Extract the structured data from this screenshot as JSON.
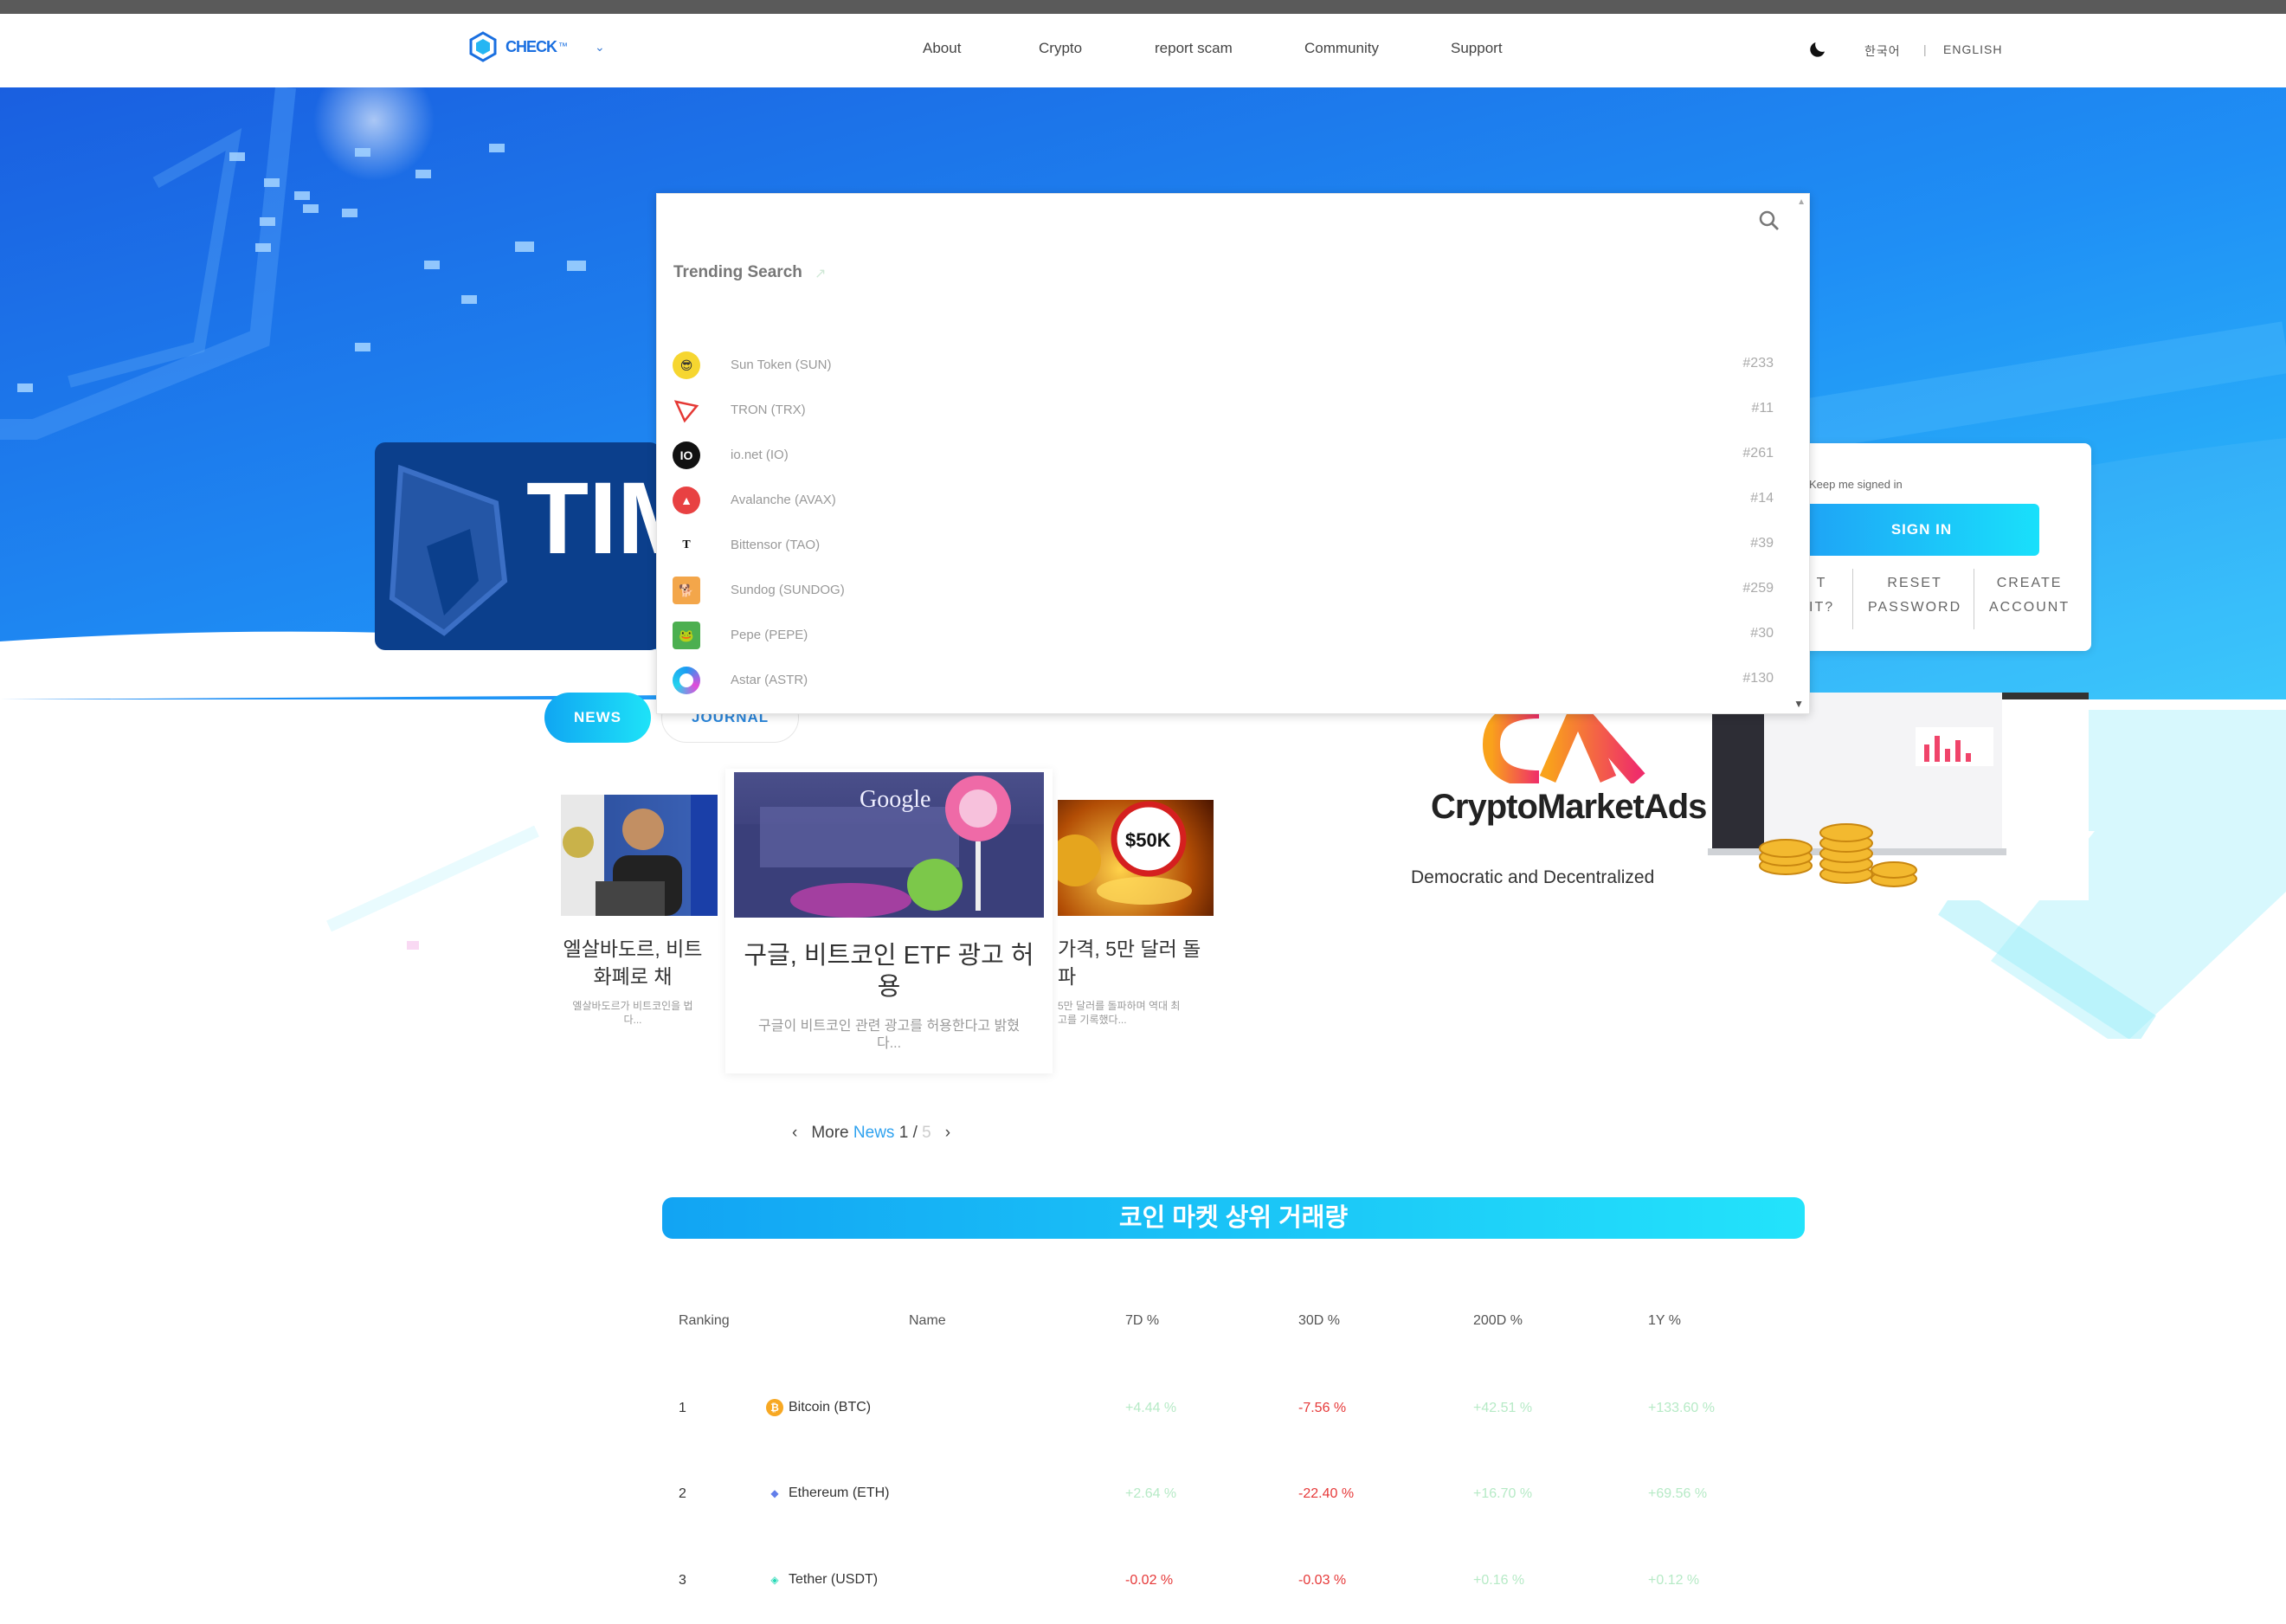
{
  "nav": {
    "logo_text": "CHECK",
    "logo_suffix": "™",
    "menu": [
      "About",
      "Crypto",
      "report scam",
      "Community",
      "Support"
    ],
    "lang_korean": "한국어",
    "lang_sep": "|",
    "lang_english": "ENGLISH"
  },
  "hero": {
    "banner_text": "TIM"
  },
  "search": {
    "trending_title": "Trending Search",
    "items": [
      {
        "name": "Sun Token (SUN)",
        "rank": "#233"
      },
      {
        "name": "TRON (TRX)",
        "rank": "#11"
      },
      {
        "name": "io.net (IO)",
        "rank": "#261"
      },
      {
        "name": "Avalanche (AVAX)",
        "rank": "#14"
      },
      {
        "name": "Bittensor (TAO)",
        "rank": "#39"
      },
      {
        "name": "Sundog (SUNDOG)",
        "rank": "#259"
      },
      {
        "name": "Pepe (PEPE)",
        "rank": "#30"
      },
      {
        "name": "Astar (ASTR)",
        "rank": "#130"
      }
    ]
  },
  "login": {
    "keep_signed": "Keep me signed in",
    "signin": "SIGN IN",
    "forgot_1": "T",
    "forgot_2": "IT?",
    "reset_1": "RESET",
    "reset_2": "PASSWORD",
    "create_1": "CREATE",
    "create_2": "ACCOUNT"
  },
  "tabs": {
    "news": "NEWS",
    "journal": "JOURNAL"
  },
  "news": [
    {
      "title": "엘살바도르, 비트\n화폐로 채",
      "desc": "엘살바도르가 비트코인을 법\n다..."
    },
    {
      "title": "구글, 비트코인 ETF 광고 허\n용",
      "desc": "구글이 비트코인 관련 광고를 허용한다고 밝혔\n다...",
      "img_text": "Google"
    },
    {
      "title": "가격, 5만 달러 돌\n파",
      "desc": "5만 달러를 돌파하며 역대 최\n고를 기록했다...",
      "img_text": "$50K"
    }
  ],
  "pager": {
    "more": "More",
    "news": "News",
    "current": "1",
    "sep": "/",
    "total": "5"
  },
  "ads": {
    "logo_text": "CM",
    "title": "CryptoMarketAds",
    "subtitle": "Democratic and Decentralized"
  },
  "volume": {
    "title": "코인 마켓 상위 거래량",
    "headers": [
      "Ranking",
      "Name",
      "7D %",
      "30D %",
      "200D %",
      "1Y %"
    ],
    "rows": [
      {
        "rank": "1",
        "name": "Bitcoin (BTC)",
        "d7": "+4.44 %",
        "d30": "-7.56 %",
        "d200": "+42.51 %",
        "y1": "+133.60 %"
      },
      {
        "rank": "2",
        "name": "Ethereum (ETH)",
        "d7": "+2.64 %",
        "d30": "-22.40 %",
        "d200": "+16.70 %",
        "y1": "+69.56 %"
      },
      {
        "rank": "3",
        "name": "Tether (USDT)",
        "d7": "-0.02 %",
        "d30": "-0.03 %",
        "d200": "+0.16 %",
        "y1": "+0.12 %"
      }
    ]
  },
  "colors": {
    "brand_blue": "#1a6fe0",
    "accent_cyan": "#1ee3f8",
    "negative": "#e63939",
    "positive": "#b6eac6"
  }
}
